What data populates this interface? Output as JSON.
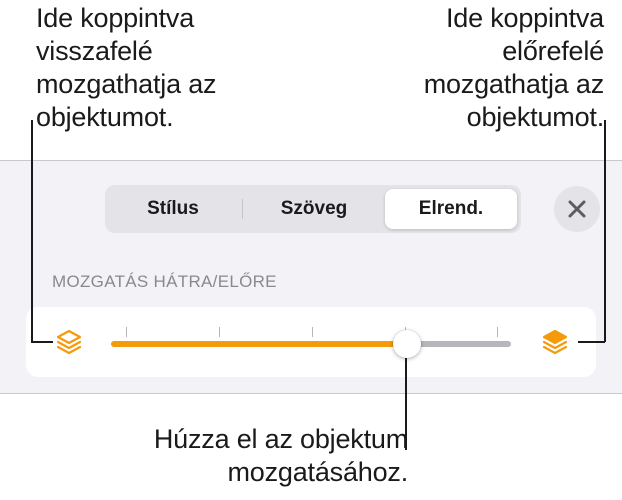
{
  "callouts": {
    "left": "Ide koppintva\nvisszafelé\nmozgathatja az\nobjektumot.",
    "right": "Ide koppintva\nelőrefelé\nmozgathatja az\nobjektumot.",
    "bottom": "Húzza el az objektum\nmozgatásához."
  },
  "tabs": [
    {
      "label": "Stílus",
      "selected": false
    },
    {
      "label": "Szöveg",
      "selected": false
    },
    {
      "label": "Elrend.",
      "selected": true
    }
  ],
  "close_icon": "close-icon",
  "section": {
    "label": "MOZGATÁS HÁTRA/ELŐRE"
  },
  "slider": {
    "value_fraction": 0.74,
    "tick_count": 4,
    "back_icon": "send-backward-layers-icon",
    "front_icon": "bring-forward-layers-icon"
  },
  "colors": {
    "accent": "#f59a0a",
    "track_inactive": "#b7b7bb",
    "panel_bg": "#f2f2f7"
  }
}
